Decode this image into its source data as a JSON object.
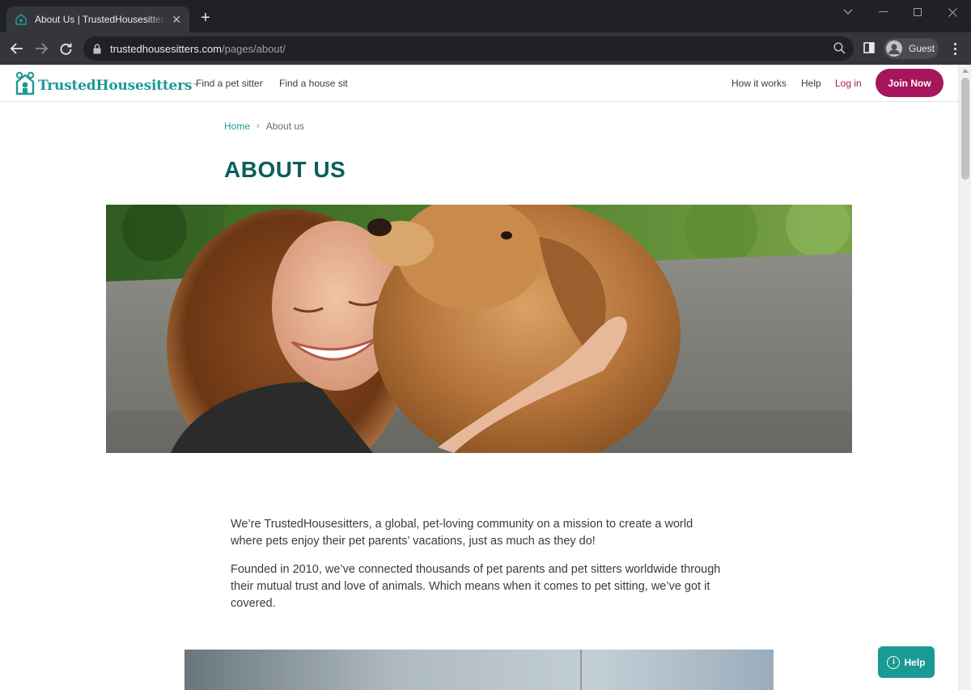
{
  "browser": {
    "tab_title": "About Us | TrustedHousesitters.com",
    "url_host": "trustedhousesitters.com",
    "url_path": "/pages/about/",
    "profile_name": "Guest"
  },
  "header": {
    "logo_text": "TrustedHousesitters",
    "logo_tm": "™",
    "nav_left": [
      "Find a pet sitter",
      "Find a house sit"
    ],
    "how_it_works": "How it works",
    "help": "Help",
    "login": "Log in",
    "join": "Join Now"
  },
  "breadcrumb": {
    "home": "Home",
    "separator": "›",
    "current": "About us"
  },
  "page_title": "ABOUT US",
  "hero": {
    "icon": "woman-hugging-dog-photo"
  },
  "body": {
    "paragraphs": [
      "We’re TrustedHousesitters, a global, pet-loving community on a mission to create a world where pets enjoy their pet parents’ vacations, just as much as they do!",
      "Founded in 2010, we’ve connected thousands of pet parents and pet sitters worldwide through their mutual trust and love of animals. Which means when it comes to pet sitting, we’ve got it covered."
    ]
  },
  "help_widget": {
    "label": "Help",
    "icon_glyph": "i"
  },
  "colors": {
    "brand_teal": "#1c9a92",
    "title_teal": "#0c5e5b",
    "join_magenta": "#a6165c"
  }
}
